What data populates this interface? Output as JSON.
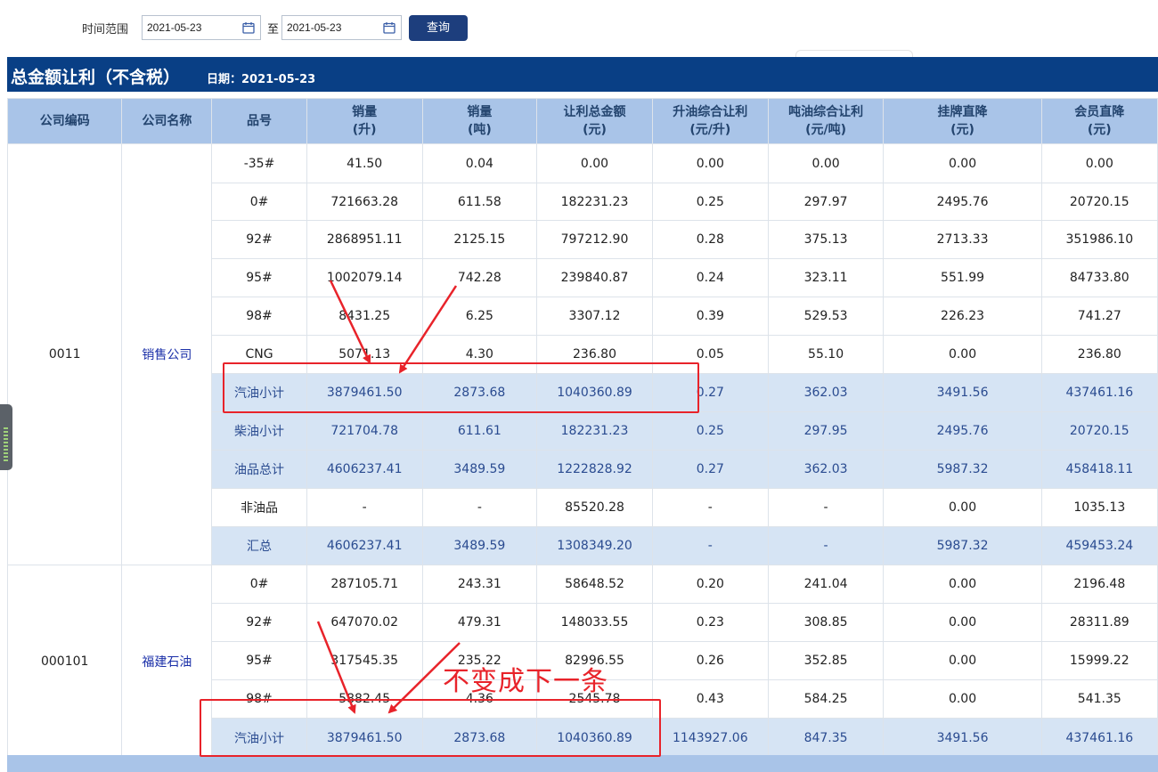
{
  "filter": {
    "label": "时间范围",
    "start": "2021-05-23",
    "sep": "至",
    "end": "2021-05-23",
    "button": "查询"
  },
  "banner": {
    "title": "总金额让利（不含税）",
    "date": "日期：2021-05-23"
  },
  "columns": [
    {
      "line1": "公司编码",
      "line2": ""
    },
    {
      "line1": "公司名称",
      "line2": ""
    },
    {
      "line1": "品号",
      "line2": ""
    },
    {
      "line1": "销量",
      "line2": "(升)"
    },
    {
      "line1": "销量",
      "line2": "(吨)"
    },
    {
      "line1": "让利总金额",
      "line2": "(元)"
    },
    {
      "line1": "升油综合让利",
      "line2": "(元/升)"
    },
    {
      "line1": "吨油综合让利",
      "line2": "(元/吨)"
    },
    {
      "line1": "挂牌直降",
      "line2": "(元)"
    },
    {
      "line1": "会员直降",
      "line2": "(元)"
    }
  ],
  "groups": [
    {
      "code": "0011",
      "name": "销售公司",
      "rows": [
        {
          "product": "-35#",
          "sub": false,
          "cells": [
            "41.50",
            "0.04",
            "0.00",
            "0.00",
            "0.00",
            "0.00",
            "0.00"
          ]
        },
        {
          "product": "0#",
          "sub": false,
          "cells": [
            "721663.28",
            "611.58",
            "182231.23",
            "0.25",
            "297.97",
            "2495.76",
            "20720.15"
          ]
        },
        {
          "product": "92#",
          "sub": false,
          "cells": [
            "2868951.11",
            "2125.15",
            "797212.90",
            "0.28",
            "375.13",
            "2713.33",
            "351986.10"
          ]
        },
        {
          "product": "95#",
          "sub": false,
          "cells": [
            "1002079.14",
            "742.28",
            "239840.87",
            "0.24",
            "323.11",
            "551.99",
            "84733.80"
          ]
        },
        {
          "product": "98#",
          "sub": false,
          "cells": [
            "8431.25",
            "6.25",
            "3307.12",
            "0.39",
            "529.53",
            "226.23",
            "741.27"
          ]
        },
        {
          "product": "CNG",
          "sub": false,
          "cells": [
            "5071.13",
            "4.30",
            "236.80",
            "0.05",
            "55.10",
            "0.00",
            "236.80"
          ]
        },
        {
          "product": "汽油小计",
          "sub": true,
          "cells": [
            "3879461.50",
            "2873.68",
            "1040360.89",
            "0.27",
            "362.03",
            "3491.56",
            "437461.16"
          ]
        },
        {
          "product": "柴油小计",
          "sub": true,
          "cells": [
            "721704.78",
            "611.61",
            "182231.23",
            "0.25",
            "297.95",
            "2495.76",
            "20720.15"
          ]
        },
        {
          "product": "油品总计",
          "sub": true,
          "cells": [
            "4606237.41",
            "3489.59",
            "1222828.92",
            "0.27",
            "362.03",
            "5987.32",
            "458418.11"
          ]
        },
        {
          "product": "非油品",
          "sub": false,
          "cells": [
            "-",
            "-",
            "85520.28",
            "-",
            "-",
            "0.00",
            "1035.13"
          ]
        },
        {
          "product": "汇总",
          "sub": true,
          "cells": [
            "4606237.41",
            "3489.59",
            "1308349.20",
            "-",
            "-",
            "5987.32",
            "459453.24"
          ]
        }
      ]
    },
    {
      "code": "000101",
      "name": "福建石油",
      "rows": [
        {
          "product": "0#",
          "sub": false,
          "cells": [
            "287105.71",
            "243.31",
            "58648.52",
            "0.20",
            "241.04",
            "0.00",
            "2196.48"
          ]
        },
        {
          "product": "92#",
          "sub": false,
          "cells": [
            "647070.02",
            "479.31",
            "148033.55",
            "0.23",
            "308.85",
            "0.00",
            "28311.89"
          ]
        },
        {
          "product": "95#",
          "sub": false,
          "cells": [
            "317545.35",
            "235.22",
            "82996.55",
            "0.26",
            "352.85",
            "0.00",
            "15999.22"
          ]
        },
        {
          "product": "98#",
          "sub": false,
          "cells": [
            "5882.45",
            "4.36",
            "2545.78",
            "0.43",
            "584.25",
            "0.00",
            "541.35"
          ]
        },
        {
          "product": "汽油小计",
          "sub": true,
          "cells": [
            "3879461.50",
            "2873.68",
            "1040360.89",
            "1143927.06",
            "847.35",
            "3491.56",
            "437461.16"
          ]
        }
      ]
    }
  ],
  "annotation": "不变成下一条",
  "colors": {
    "banner": "#093f85",
    "header": "#a9c4e8",
    "subtotal_row": "#d6e4f4",
    "annotation_red": "#e8232a",
    "button": "#1d3e7d"
  }
}
